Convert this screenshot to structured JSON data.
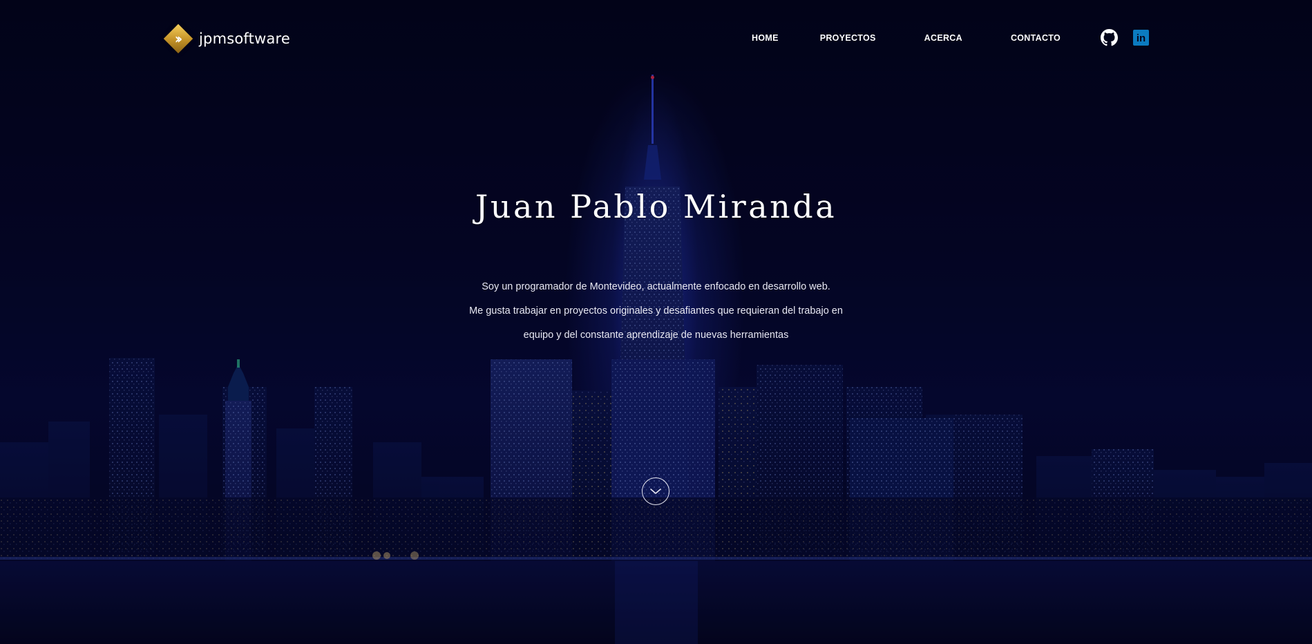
{
  "brand": {
    "name": "jpmsoftware",
    "logo_icon": "double-chevron-diamond-icon",
    "accent_color": "#d6a535"
  },
  "nav": {
    "items": [
      {
        "label": "HOME"
      },
      {
        "label": "PROYECTOS"
      },
      {
        "label": "ACERCA"
      },
      {
        "label": "CONTACTO"
      }
    ],
    "social": [
      {
        "icon": "github-icon"
      },
      {
        "icon": "linkedin-icon",
        "glyph": "in",
        "color": "#0b7bc0"
      }
    ]
  },
  "hero": {
    "title": "Juan Pablo Miranda",
    "lines": [
      "Soy un programador de Montevideo, actualmente enfocado en desarrollo web.",
      "Me gusta trabajar en proyectos originales y desafiantes que requieran del trabajo en",
      "equipo y del constante aprendizaje de nuevas herramientas"
    ],
    "scroll_icon": "chevron-down-circle-icon"
  },
  "theme": {
    "background": "#05061c",
    "text": "#ffffff"
  }
}
